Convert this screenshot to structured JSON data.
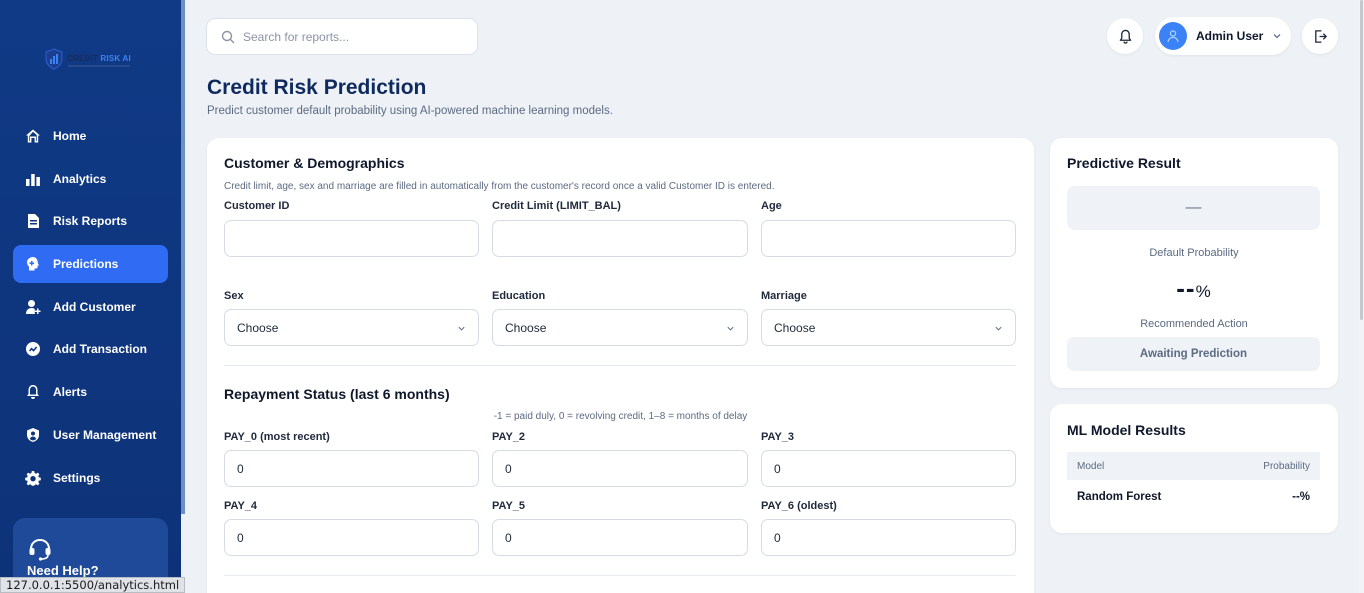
{
  "brand": {
    "logo_text_a": "CREDIT",
    "logo_text_b": "RISK AI"
  },
  "sidebar": {
    "items": [
      {
        "label": "Home",
        "icon": "home-icon",
        "active": false
      },
      {
        "label": "Analytics",
        "icon": "bar-chart-icon",
        "active": false
      },
      {
        "label": "Risk Reports",
        "icon": "report-icon",
        "active": false
      },
      {
        "label": "Predictions",
        "icon": "brain-icon",
        "active": true
      },
      {
        "label": "Add Customer",
        "icon": "add-user-icon",
        "active": false
      },
      {
        "label": "Add Transaction",
        "icon": "transaction-icon",
        "active": false
      },
      {
        "label": "Alerts",
        "icon": "bell-icon",
        "active": false
      },
      {
        "label": "User Management",
        "icon": "shield-user-icon",
        "active": false
      },
      {
        "label": "Settings",
        "icon": "gear-icon",
        "active": false
      }
    ],
    "help_title": "Need Help?"
  },
  "status_url": "127.0.0.1:5500/analytics.html",
  "header": {
    "search_placeholder": "Search for reports...",
    "user_name": "Admin User"
  },
  "page": {
    "title": "Credit Risk Prediction",
    "subtitle": "Predict customer default probability using AI-powered machine learning models."
  },
  "demographics": {
    "title": "Customer & Demographics",
    "note": "Credit limit, age, sex and marriage are filled in automatically from the customer's record once a valid Customer ID is entered.",
    "customer_id_label": "Customer ID",
    "customer_id_value": "",
    "credit_limit_label": "Credit Limit (LIMIT_BAL)",
    "credit_limit_value": "",
    "age_label": "Age",
    "age_value": "",
    "sex_label": "Sex",
    "sex_value": "Choose",
    "education_label": "Education",
    "education_value": "Choose",
    "marriage_label": "Marriage",
    "marriage_value": "Choose"
  },
  "repayment": {
    "title": "Repayment Status (last 6 months)",
    "note": "-1 = paid duly, 0 = revolving credit, 1–8 = months of delay",
    "fields": [
      {
        "label": "PAY_0 (most recent)",
        "value": "0"
      },
      {
        "label": "PAY_2",
        "value": "0"
      },
      {
        "label": "PAY_3",
        "value": "0"
      },
      {
        "label": "PAY_4",
        "value": "0"
      },
      {
        "label": "PAY_5",
        "value": "0"
      },
      {
        "label": "PAY_6 (oldest)",
        "value": "0"
      }
    ]
  },
  "result": {
    "title": "Predictive Result",
    "result_placeholder": "—",
    "probability_label": "Default Probability",
    "probability_value": "--",
    "probability_unit": "%",
    "action_label": "Recommended Action",
    "action_value": "Awaiting Prediction"
  },
  "ml": {
    "title": "ML Model Results",
    "col_model": "Model",
    "col_probability": "Probability",
    "rows": [
      {
        "model": "Random Forest",
        "probability": "--%"
      }
    ]
  }
}
